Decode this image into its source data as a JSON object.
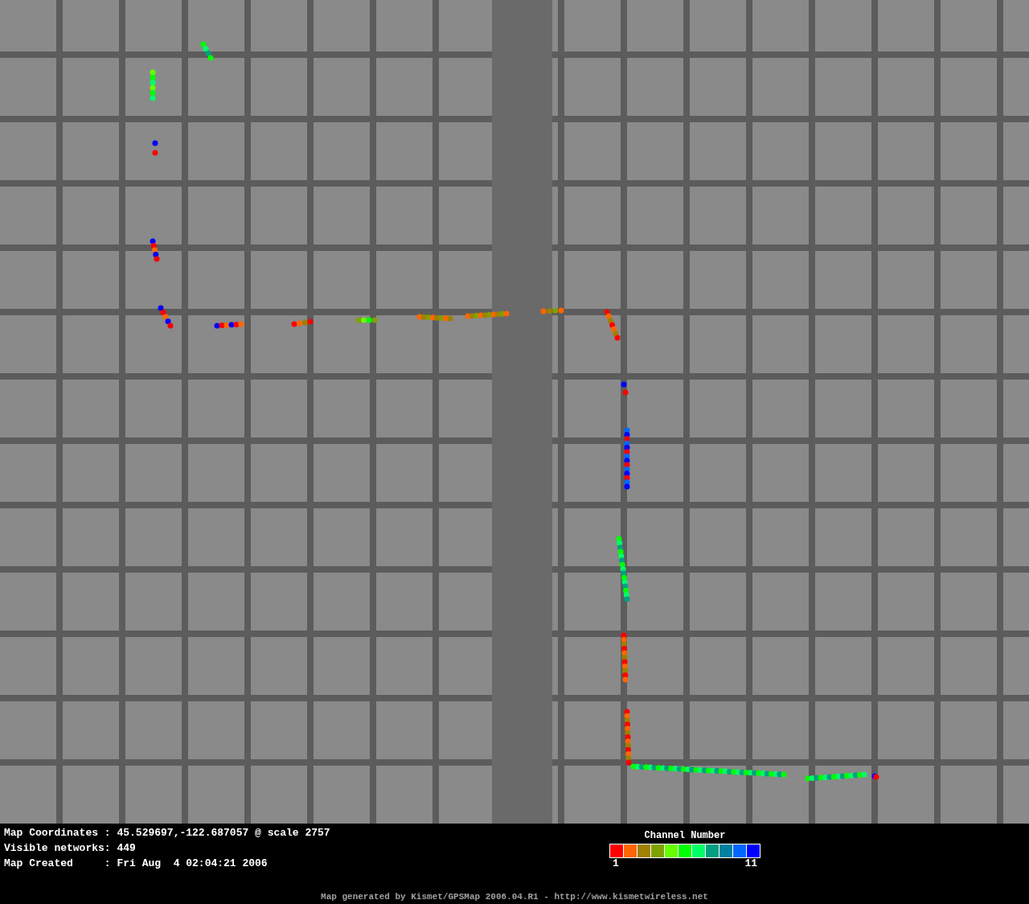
{
  "map": {
    "info_lines": [
      "Map Coordinates : 45.529697,-122.687057 @ scale 2757",
      "Visible networks: 449",
      "Map Created     : Fri Aug  4 02:04:21 2006"
    ]
  },
  "legend": {
    "title": "Channel Number",
    "swatches": [
      {
        "color": "#ff0000"
      },
      {
        "color": "#ff6600"
      },
      {
        "color": "#a08000"
      },
      {
        "color": "#80a000"
      },
      {
        "color": "#66ff00"
      },
      {
        "color": "#00ff00"
      },
      {
        "color": "#00ff66"
      },
      {
        "color": "#00a080"
      },
      {
        "color": "#0080a0"
      },
      {
        "color": "#0066ff"
      },
      {
        "color": "#0000ff"
      }
    ],
    "min_label": "1",
    "max_label": "11"
  },
  "footer": "Map generated by Kismet/GPSMap 2006.04.R1 - http://www.kismetwireless.net"
}
